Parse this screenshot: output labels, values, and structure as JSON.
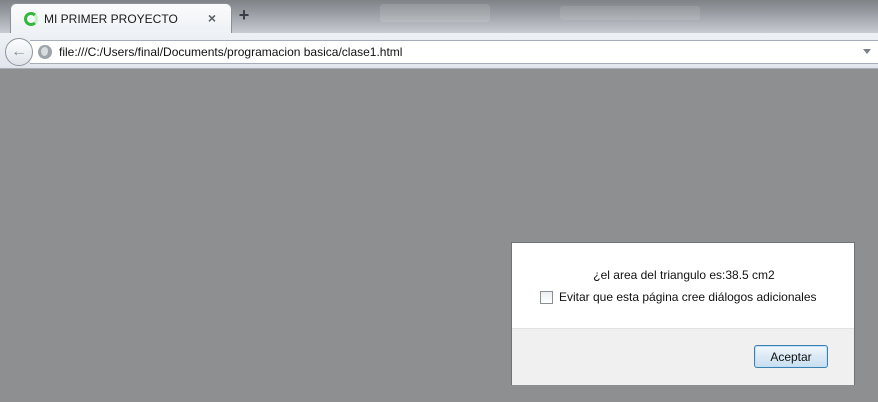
{
  "browser": {
    "tab": {
      "title": "MI PRIMER PROYECTO",
      "close_glyph": "×",
      "loader_icon": "loading-spinner-icon"
    },
    "new_tab_glyph": "+",
    "back_glyph": "←",
    "url": "file:///C:/Users/final/Documents/programacion basica/clase1.html",
    "accent_color": "#32b83a"
  },
  "dialog": {
    "message": "¿el area del triangulo es:38.5 cm2",
    "checkbox_label": "Evitar que esta página cree diálogos adicionales",
    "checkbox_checked": false,
    "ok_label": "Aceptar"
  }
}
